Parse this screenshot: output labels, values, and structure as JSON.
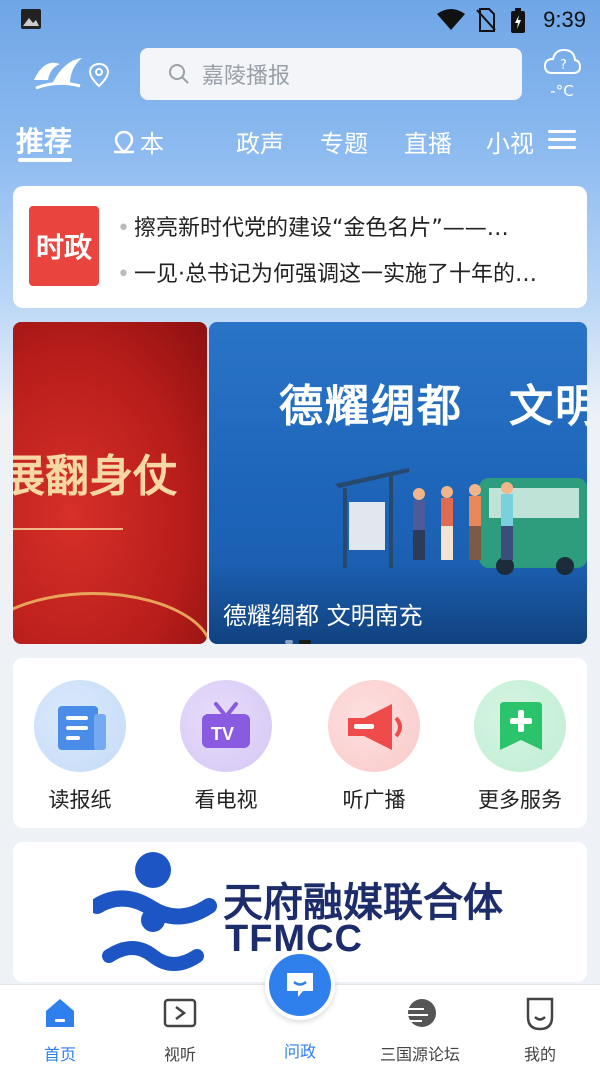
{
  "status_bar": {
    "time": "9:39"
  },
  "header": {
    "search_placeholder": "嘉陵播报",
    "weather_temp": "-°C"
  },
  "tabs": [
    "推荐",
    "本",
    "政声",
    "专题",
    "直播",
    "小视"
  ],
  "news": {
    "badge": "时政",
    "items": [
      "擦亮新时代党的建设“金色名片”——…",
      "一见·总书记为何强调这一实施了十年的…"
    ]
  },
  "banner": {
    "left_text": "展翻身仗",
    "main_title": "德耀绸都　文明",
    "caption": "德耀绸都 文明南充",
    "active_index": 1
  },
  "services": [
    {
      "label": "读报纸",
      "icon": "newspaper-icon",
      "color": "#4a8de8"
    },
    {
      "label": "看电视",
      "icon": "tv-icon",
      "color": "#8a5be0"
    },
    {
      "label": "听广播",
      "icon": "megaphone-icon",
      "color": "#ef4b4b"
    },
    {
      "label": "更多服务",
      "icon": "plus-service-icon",
      "color": "#2bc36b"
    }
  ],
  "ad": {
    "title": "天府融媒联合体",
    "subtitle": "TFMCC"
  },
  "bottom_nav": [
    {
      "label": "首页",
      "active": true
    },
    {
      "label": "视听",
      "active": false
    },
    {
      "label": "问政",
      "active": false
    },
    {
      "label": "三国源论坛",
      "active": false
    },
    {
      "label": "我的",
      "active": false
    }
  ],
  "colors": {
    "accent": "#2f80ed",
    "badge_red": "#e9443e",
    "ad_navy": "#1d2d6b"
  }
}
